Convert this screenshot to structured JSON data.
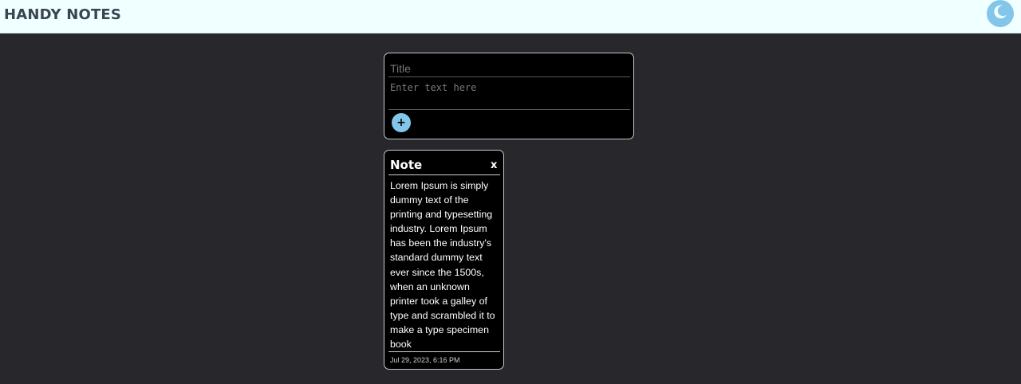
{
  "header": {
    "app_title": "HANDY NOTES",
    "theme_toggle_icon": "moon-icon",
    "accent_color": "#84c6ea",
    "background_color": "#f0ffff"
  },
  "composer": {
    "title_placeholder": "Title",
    "title_value": "",
    "text_placeholder": "Enter text here",
    "text_value": "",
    "add_button_label": "+",
    "add_button_icon": "plus-icon"
  },
  "notes": [
    {
      "title": "Note",
      "close_label": "x",
      "body": "Lorem Ipsum is simply dummy text of the printing and typesetting industry. Lorem Ipsum has been the industry's standard dummy text ever since the 1500s, when an unknown printer took a galley of type and scrambled it to make a type specimen book",
      "date": "Jul 29, 2023, 6:16 PM"
    }
  ]
}
